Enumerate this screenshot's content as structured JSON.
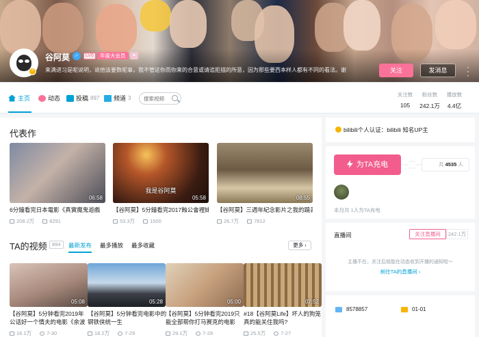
{
  "profile": {
    "username": "谷阿莫",
    "level_badge": "LV6",
    "vip_badge": "年度大会员",
    "signature": "来满进习是呢说明，说他该要数呢事，我不管这你而你来的合意或请追拒描的所意，因为那些要西本样人都有不同的看法。谢谢",
    "follow_label": "关注",
    "message_label": "发消息"
  },
  "nav": {
    "home": "主页",
    "dynamic": "动态",
    "videos": "投稿",
    "videos_count": "897",
    "channels": "频道",
    "channels_count": "3",
    "search_placeholder": "搜索视频"
  },
  "stats": [
    {
      "label": "关注数",
      "value": "105"
    },
    {
      "label": "粉丝数",
      "value": "242.1万"
    },
    {
      "label": "播放数",
      "value": "4.4亿"
    }
  ],
  "masterpiece": {
    "title": "代表作",
    "videos": [
      {
        "duration": "06:58",
        "caption": "",
        "title": "6分鐘看完日本電影《真實魔鬼遊戲",
        "plays": "208.2万",
        "danmaku": "8291"
      },
      {
        "duration": "05:58",
        "caption": "我是谷阿莫",
        "title": "【谷阿莫】5分鐘看完2017蝕公會裡妹子",
        "plays": "53.3万",
        "danmaku": "1500"
      },
      {
        "duration": "08:55",
        "caption": "",
        "title": "【谷阿莫】三週年紀念影片之我的蹺丟",
        "plays": "26.7万",
        "danmaku": "7812"
      }
    ]
  },
  "ta_videos": {
    "title": "TA的视频",
    "count": "894",
    "tabs": [
      "最新发布",
      "最多播放",
      "最多收藏"
    ],
    "more_label": "更多",
    "videos": [
      {
        "duration": "05:08",
        "title": "【谷阿莫】5分钟看完2019年公话好一个情夫的电影《余波",
        "plays": "16.1万",
        "date": "7-30"
      },
      {
        "duration": "05:28",
        "title": "【谷阿莫】5分钟看完电影中的钢铁侠统一生",
        "plays": "18.2万",
        "date": "7-29"
      },
      {
        "duration": "05:00",
        "title": "【谷阿莫】5分钟看完2019只能全部帮你打马赛克的电影",
        "plays": "29.1万",
        "date": "7-28"
      },
      {
        "duration": "07:52",
        "title": "#18【谷阿莫Life】坏人的狗笼真的能关住我吗?",
        "plays": "25.5万",
        "date": "7-27"
      }
    ]
  },
  "certification": {
    "text": "bilibili个人认证：bilibili 知名UP主"
  },
  "charge": {
    "button_label": "为TA充电",
    "count_prefix": "共",
    "count": "4535",
    "count_suffix": "人",
    "note": "本月共 1人为TA充电"
  },
  "live": {
    "title": "直播间",
    "follow_label": "关注直播间",
    "follow_count": "242.1万",
    "message": "主播不在，关注后就能在动态收到开播的通知啦～",
    "link_label": "前往TA的直播间"
  },
  "info": {
    "uid": "8578857",
    "birthday": "01-01"
  }
}
